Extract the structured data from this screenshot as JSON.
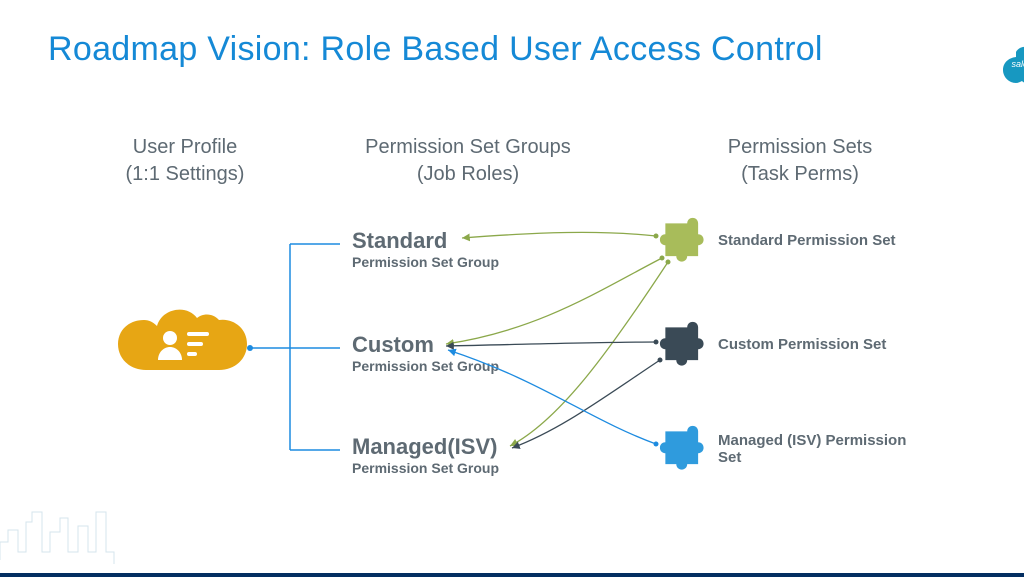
{
  "title": "Roadmap Vision: Role Based User Access Control",
  "brand": "salesforce",
  "columns": {
    "profile": {
      "title": "User Profile",
      "subtitle": "(1:1 Settings)"
    },
    "groups": {
      "title": "Permission Set Groups",
      "subtitle": "(Job Roles)"
    },
    "sets": {
      "title": "Permission Sets",
      "subtitle": "(Task Perms)"
    }
  },
  "groups": [
    {
      "title": "Standard",
      "subtitle": "Permission Set Group"
    },
    {
      "title": "Custom",
      "subtitle": "Permission Set Group"
    },
    {
      "title": "Managed(ISV)",
      "subtitle": "Permission Set Group"
    }
  ],
  "sets": [
    {
      "label": "Standard Permission Set",
      "color": "#a8bc5a"
    },
    {
      "label": "Custom Permission Set",
      "color": "#3a4a56"
    },
    {
      "label": "Managed (ISV) Permission Set",
      "color": "#2f9bdd"
    }
  ],
  "colors": {
    "title": "#1589d6",
    "text": "#5e6a73",
    "cloud": "#e7a614",
    "line_blue": "#1d8be0",
    "line_green": "#8ba84a",
    "line_dark": "#3a4a56",
    "sf_cloud": "#1798c1"
  }
}
